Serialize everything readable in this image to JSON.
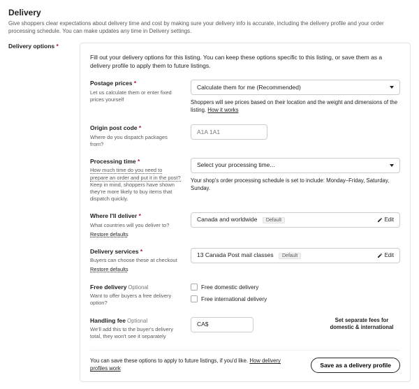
{
  "header": {
    "title": "Delivery",
    "subtitle": "Give shoppers clear expectations about delivery time and cost by making sure your delivery info is accurate, including the delivery profile and your order processing schedule. You can make updates any time in Delivery settings."
  },
  "side": {
    "label": "Delivery options"
  },
  "panel": {
    "intro": "Fill out your delivery options for this listing. You can keep these options specific to this listing, or save them as a delivery profile to apply them to future listings.",
    "postage": {
      "title": "Postage prices",
      "sub": "Let us calculate them or enter fixed prices yourself",
      "selected": "Calculate them for me (Recommended)",
      "hint_prefix": "Shoppers will see prices based on their location and the weight and dimensions of the listing. ",
      "hint_link": "How it works"
    },
    "origin": {
      "title": "Origin post code",
      "sub": "Where do you dispatch packages from?",
      "placeholder": "A1A 1A1"
    },
    "processing": {
      "title": "Processing time",
      "sub_dotted": "How much time do you need to prepare an order and put it in the post?",
      "sub_rest": " Keep in mind, shoppers have shown they're more likely to buy items that dispatch quickly.",
      "selected": "Select your processing time...",
      "hint": "Your shop's order processing schedule is set to include: Monday–Friday, Saturday, Sunday."
    },
    "deliver": {
      "title": "Where I'll deliver",
      "sub": "What countries will you deliver to?",
      "restore": "Restore defaults",
      "value": "Canada and worldwide",
      "badge": "Default",
      "edit": "Edit"
    },
    "services": {
      "title": "Delivery services",
      "sub": "Buyers can choose these at checkout",
      "restore": "Restore defaults",
      "value": "13 Canada Post mail classes",
      "badge": "Default",
      "edit": "Edit"
    },
    "free": {
      "title": "Free delivery",
      "optional": "Optional",
      "sub": "Want to offer buyers a free delivery option?",
      "domestic": "Free domestic delivery",
      "international": "Free international delivery"
    },
    "handling": {
      "title": "Handling fee",
      "optional": "Optional",
      "sub": "We'll add this to the buyer's delivery total, they won't see it separately",
      "currency": "CA$",
      "separate": "Set separate fees for domestic & international"
    },
    "footer": {
      "text": "You can save these options to apply to future listings, if you'd like. ",
      "link": "How delivery profiles work",
      "button": "Save as a delivery profile"
    }
  }
}
